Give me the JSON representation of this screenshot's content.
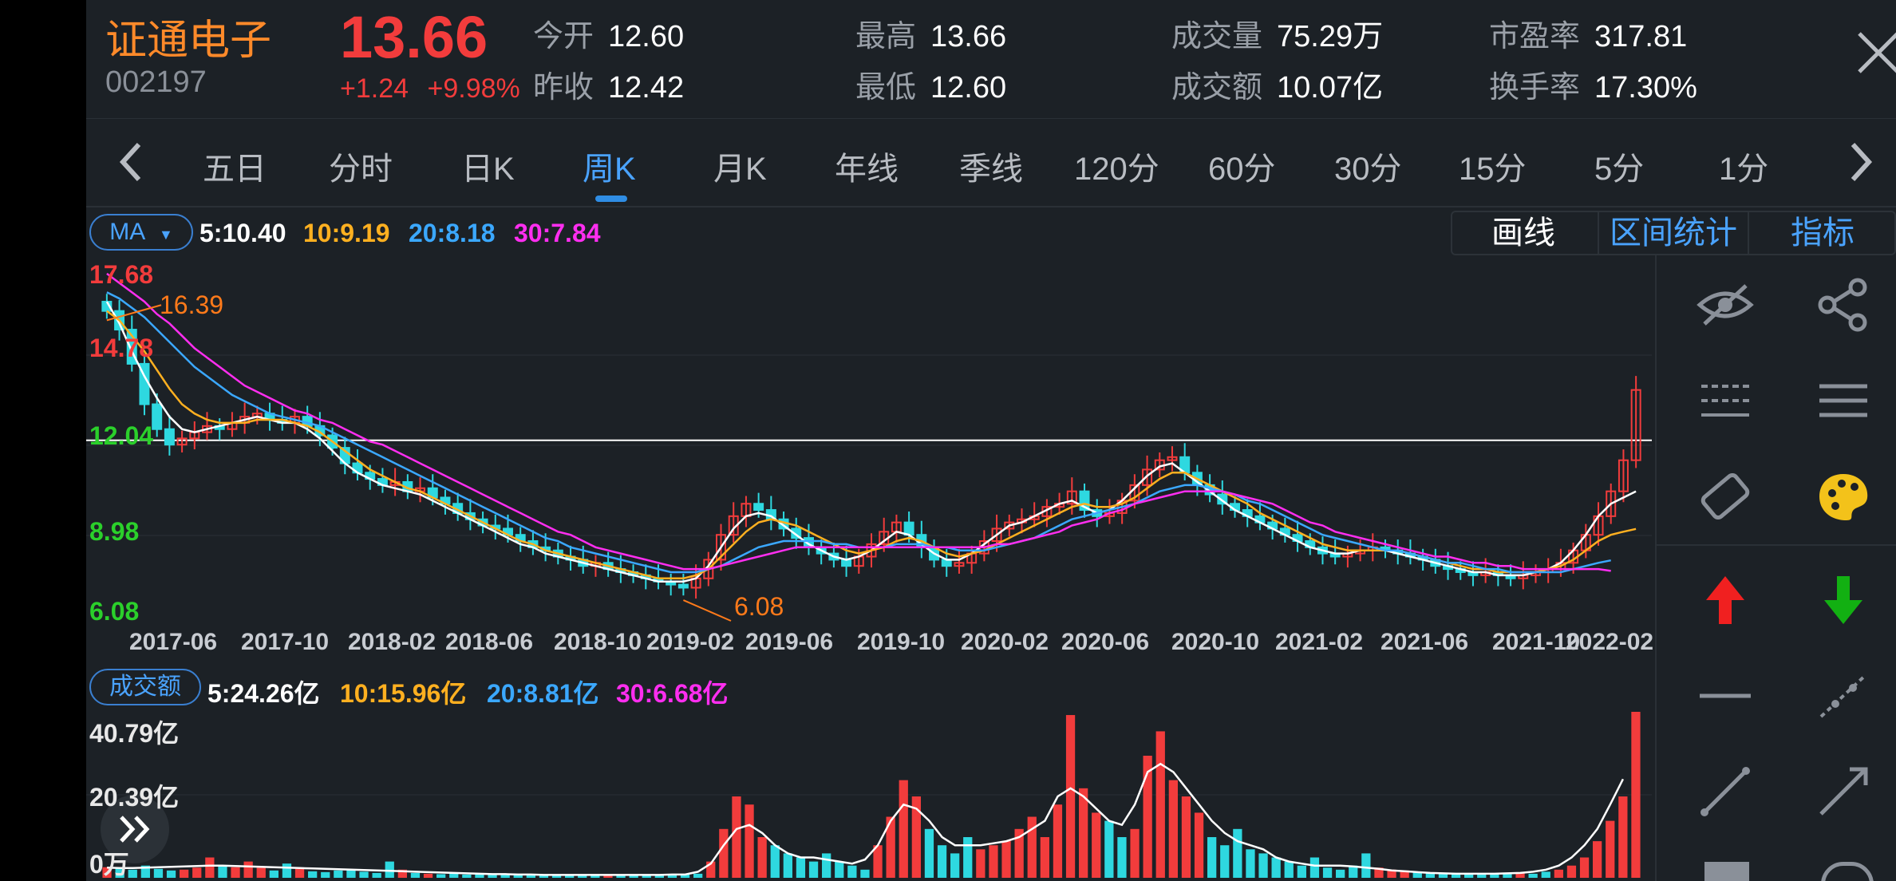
{
  "header": {
    "name": "证通电子",
    "code": "002197",
    "price": "13.66",
    "change": "+1.24",
    "change_pct": "+9.98%",
    "stats": [
      {
        "label": "今开",
        "value": "12.60"
      },
      {
        "label": "昨收",
        "value": "12.42"
      },
      {
        "label": "最高",
        "value": "13.66"
      },
      {
        "label": "最低",
        "value": "12.60"
      },
      {
        "label": "成交量",
        "value": "75.29万"
      },
      {
        "label": "成交额",
        "value": "10.07亿"
      },
      {
        "label": "市盈率",
        "value": "317.81"
      },
      {
        "label": "换手率",
        "value": "17.30%"
      }
    ]
  },
  "tabs": [
    "五日",
    "分时",
    "日K",
    "周K",
    "月K",
    "年线",
    "季线",
    "120分",
    "60分",
    "30分",
    "15分",
    "5分",
    "1分"
  ],
  "active_tab": "周K",
  "ma_bar": {
    "indicator": "MA",
    "values": [
      "5:10.40",
      "10:9.19",
      "20:8.18",
      "30:7.84"
    ]
  },
  "tool_buttons": [
    "画线",
    "区间统计",
    "指标"
  ],
  "vol_bar": {
    "indicator": "成交额",
    "values": [
      "5:24.26亿",
      "10:15.96亿",
      "20:8.81亿",
      "30:6.68亿"
    ]
  },
  "colors": {
    "up": "#f23c3c",
    "down": "#2ed8e0",
    "ma5": "#ffffff",
    "ma10": "#ffb020",
    "ma20": "#3ba8ff",
    "ma30": "#ff2ef0",
    "accent": "#2f8de4"
  },
  "icons": [
    "eye-off-icon",
    "share-icon",
    "dashed-lines-icon",
    "solid-lines-icon",
    "eraser-icon",
    "palette-icon",
    "red-up-arrow-icon",
    "green-down-arrow-icon",
    "horizontal-line-icon",
    "dotted-segment-icon",
    "segment-icon",
    "ray-icon",
    "close-icon",
    "chevron-left-icon",
    "chevron-right-icon",
    "double-chevron-right-icon"
  ],
  "chart_data": [
    {
      "type": "candlestick",
      "title": "",
      "y_labels": [
        "17.68",
        "14.78",
        "12.04",
        "8.98",
        "6.08"
      ],
      "y_label_colors": [
        "#f23c3c",
        "#f23c3c",
        "#2bd02b",
        "#2bd02b",
        "#2bd02b"
      ],
      "ylim": [
        6.08,
        17.68
      ],
      "x_labels": [
        "2017-06",
        "2017-10",
        "2018-02",
        "2018-06",
        "2018-10",
        "2019-02",
        "2019-06",
        "2019-10",
        "2020-02",
        "2020-06",
        "2020-10",
        "2021-02",
        "2021-06",
        "2021-10",
        "2022-02"
      ],
      "annotations": {
        "high": "16.39",
        "low": "6.08"
      },
      "reference_line": 12.04,
      "close": [
        16.2,
        15.6,
        14.5,
        13.2,
        12.4,
        11.9,
        12.1,
        12.3,
        12.5,
        12.4,
        12.6,
        12.8,
        12.9,
        12.7,
        12.6,
        12.8,
        12.5,
        12.2,
        11.8,
        11.3,
        11.0,
        10.8,
        10.6,
        10.7,
        10.4,
        10.5,
        10.2,
        10.0,
        9.7,
        9.5,
        9.3,
        9.2,
        9.0,
        8.8,
        8.6,
        8.5,
        8.3,
        8.2,
        8.0,
        8.1,
        7.9,
        7.8,
        7.7,
        7.6,
        7.5,
        7.4,
        7.3,
        7.6,
        8.2,
        9.0,
        9.6,
        10.0,
        9.8,
        9.5,
        9.2,
        8.9,
        8.6,
        8.4,
        8.2,
        8.0,
        8.3,
        8.7,
        9.1,
        9.4,
        9.0,
        8.6,
        8.2,
        8.0,
        8.1,
        8.4,
        8.8,
        9.2,
        9.4,
        9.5,
        9.6,
        9.9,
        10.0,
        10.4,
        9.8,
        9.6,
        9.7,
        10.1,
        10.6,
        11.1,
        11.4,
        11.5,
        11.0,
        10.6,
        10.3,
        10.0,
        9.8,
        9.6,
        9.4,
        9.2,
        9.0,
        8.8,
        8.6,
        8.4,
        8.3,
        8.4,
        8.5,
        8.6,
        8.5,
        8.4,
        8.3,
        8.2,
        8.0,
        7.9,
        7.8,
        7.7,
        7.8,
        7.7,
        7.6,
        7.7,
        7.8,
        7.9,
        8.1,
        8.5,
        9.0,
        9.6,
        10.4,
        11.4,
        13.66
      ],
      "ma": {
        "5": [
          16.5,
          15.8,
          14.9,
          14.1,
          13.4,
          12.8,
          12.4,
          12.3,
          12.4,
          12.5,
          12.6,
          12.7,
          12.8,
          12.7,
          12.6,
          12.6,
          12.4,
          12.1,
          11.7,
          11.3,
          11.0,
          10.8,
          10.6,
          10.5,
          10.4,
          10.3,
          10.1,
          9.9,
          9.7,
          9.5,
          9.3,
          9.1,
          8.9,
          8.7,
          8.6,
          8.4,
          8.3,
          8.2,
          8.1,
          8.0,
          7.9,
          7.8,
          7.7,
          7.6,
          7.5,
          7.5,
          7.5,
          7.6,
          8.0,
          8.6,
          9.2,
          9.6,
          9.7,
          9.6,
          9.3,
          9.0,
          8.7,
          8.5,
          8.3,
          8.2,
          8.3,
          8.5,
          8.8,
          9.1,
          9.0,
          8.7,
          8.4,
          8.2,
          8.2,
          8.4,
          8.7,
          9.0,
          9.3,
          9.4,
          9.6,
          9.8,
          10.0,
          10.1,
          9.9,
          9.7,
          9.8,
          10.1,
          10.5,
          10.9,
          11.2,
          11.3,
          11.0,
          10.7,
          10.4,
          10.1,
          9.8,
          9.6,
          9.4,
          9.2,
          9.0,
          8.8,
          8.6,
          8.5,
          8.4,
          8.4,
          8.5,
          8.5,
          8.5,
          8.4,
          8.3,
          8.2,
          8.1,
          8.0,
          7.9,
          7.8,
          7.8,
          7.7,
          7.7,
          7.7,
          7.8,
          7.9,
          8.1,
          8.5,
          9.0,
          9.6,
          10.0,
          10.2,
          10.4
        ],
        "10": [
          16.2,
          15.9,
          15.4,
          14.9,
          14.3,
          13.7,
          13.2,
          12.9,
          12.7,
          12.6,
          12.6,
          12.6,
          12.7,
          12.7,
          12.7,
          12.6,
          12.5,
          12.3,
          12.0,
          11.7,
          11.4,
          11.1,
          10.9,
          10.7,
          10.5,
          10.4,
          10.2,
          10.0,
          9.8,
          9.6,
          9.4,
          9.2,
          9.0,
          8.8,
          8.7,
          8.5,
          8.4,
          8.3,
          8.2,
          8.1,
          8.0,
          7.9,
          7.8,
          7.7,
          7.6,
          7.6,
          7.6,
          7.7,
          7.9,
          8.3,
          8.7,
          9.1,
          9.4,
          9.5,
          9.4,
          9.3,
          9.1,
          8.9,
          8.7,
          8.5,
          8.4,
          8.5,
          8.6,
          8.8,
          8.9,
          8.8,
          8.6,
          8.4,
          8.3,
          8.4,
          8.5,
          8.7,
          8.9,
          9.1,
          9.3,
          9.5,
          9.7,
          9.9,
          10.0,
          9.9,
          9.9,
          10.0,
          10.2,
          10.5,
          10.8,
          11.0,
          11.0,
          10.8,
          10.6,
          10.4,
          10.2,
          10.0,
          9.7,
          9.5,
          9.3,
          9.1,
          8.9,
          8.7,
          8.6,
          8.5,
          8.5,
          8.5,
          8.5,
          8.5,
          8.4,
          8.3,
          8.2,
          8.1,
          8.0,
          7.9,
          7.9,
          7.8,
          7.8,
          7.8,
          7.8,
          7.9,
          8.0,
          8.2,
          8.5,
          8.8,
          9.0,
          9.1,
          9.19
        ],
        "20": [
          16.8,
          16.6,
          16.3,
          16.0,
          15.6,
          15.2,
          14.8,
          14.4,
          14.1,
          13.8,
          13.5,
          13.3,
          13.1,
          12.9,
          12.8,
          12.7,
          12.6,
          12.5,
          12.3,
          12.1,
          11.9,
          11.7,
          11.5,
          11.3,
          11.1,
          10.9,
          10.7,
          10.5,
          10.3,
          10.1,
          9.9,
          9.7,
          9.5,
          9.3,
          9.1,
          8.9,
          8.8,
          8.6,
          8.5,
          8.4,
          8.3,
          8.2,
          8.1,
          8.0,
          7.9,
          7.8,
          7.8,
          7.8,
          7.9,
          8.0,
          8.2,
          8.4,
          8.6,
          8.7,
          8.8,
          8.8,
          8.8,
          8.8,
          8.7,
          8.7,
          8.6,
          8.6,
          8.6,
          8.7,
          8.7,
          8.7,
          8.6,
          8.6,
          8.5,
          8.5,
          8.5,
          8.6,
          8.7,
          8.8,
          8.9,
          9.1,
          9.3,
          9.5,
          9.6,
          9.7,
          9.8,
          9.9,
          10.0,
          10.2,
          10.4,
          10.5,
          10.6,
          10.6,
          10.5,
          10.4,
          10.3,
          10.1,
          10.0,
          9.8,
          9.6,
          9.4,
          9.2,
          9.0,
          8.9,
          8.8,
          8.7,
          8.6,
          8.5,
          8.5,
          8.4,
          8.3,
          8.2,
          8.1,
          8.1,
          8.0,
          7.9,
          7.9,
          7.8,
          7.8,
          7.8,
          7.8,
          7.8,
          7.9,
          8.0,
          8.1,
          8.18
        ],
        "30": [
          17.4,
          17.1,
          16.8,
          16.5,
          16.1,
          15.8,
          15.4,
          15.0,
          14.7,
          14.4,
          14.1,
          13.8,
          13.6,
          13.4,
          13.2,
          13.0,
          12.9,
          12.7,
          12.6,
          12.4,
          12.2,
          12.0,
          11.9,
          11.7,
          11.5,
          11.3,
          11.1,
          10.9,
          10.7,
          10.5,
          10.3,
          10.1,
          9.9,
          9.7,
          9.5,
          9.3,
          9.1,
          9.0,
          8.8,
          8.6,
          8.5,
          8.4,
          8.3,
          8.2,
          8.1,
          8.0,
          7.9,
          7.9,
          7.9,
          8.0,
          8.1,
          8.2,
          8.3,
          8.4,
          8.5,
          8.6,
          8.6,
          8.6,
          8.6,
          8.6,
          8.6,
          8.6,
          8.6,
          8.6,
          8.6,
          8.6,
          8.6,
          8.6,
          8.6,
          8.6,
          8.6,
          8.7,
          8.7,
          8.8,
          8.9,
          9.0,
          9.1,
          9.3,
          9.4,
          9.5,
          9.7,
          9.8,
          10.0,
          10.1,
          10.2,
          10.3,
          10.4,
          10.4,
          10.4,
          10.4,
          10.3,
          10.2,
          10.1,
          10.0,
          9.8,
          9.6,
          9.4,
          9.3,
          9.1,
          9.0,
          8.9,
          8.8,
          8.7,
          8.6,
          8.5,
          8.4,
          8.3,
          8.3,
          8.2,
          8.1,
          8.1,
          8.0,
          8.0,
          7.9,
          7.9,
          7.9,
          7.9,
          7.9,
          7.9,
          7.9,
          7.84
        ]
      }
    },
    {
      "type": "bar",
      "title": "",
      "y_labels": [
        "40.79亿",
        "20.39亿",
        "0万"
      ],
      "ylim": [
        0,
        40.79
      ],
      "unit": "亿",
      "values": [
        2.6,
        2.4,
        2.0,
        3.0,
        2.2,
        1.8,
        2.0,
        2.5,
        5.0,
        3.0,
        2.6,
        4.0,
        2.5,
        1.8,
        3.5,
        2.2,
        1.6,
        1.4,
        1.8,
        2.0,
        1.5,
        1.2,
        4.0,
        2.0,
        1.2,
        1.0,
        0.9,
        1.0,
        0.8,
        1.1,
        0.9,
        0.8,
        0.7,
        0.6,
        0.8,
        0.6,
        0.5,
        0.7,
        0.6,
        0.8,
        0.7,
        0.6,
        0.7,
        0.6,
        0.9,
        0.8,
        1.0,
        4.0,
        12.0,
        20.0,
        18.0,
        10.0,
        8.0,
        6.0,
        5.0,
        4.0,
        6.0,
        4.0,
        3.0,
        2.0,
        8.0,
        15.0,
        24.0,
        20.0,
        12.0,
        8.0,
        6.0,
        10.0,
        7.0,
        8.0,
        9.0,
        12.0,
        15.0,
        10.0,
        18.0,
        40.0,
        22.0,
        16.0,
        14.0,
        10.0,
        12.0,
        30.0,
        36.0,
        24.0,
        20.0,
        16.0,
        10.0,
        8.0,
        12.0,
        7.0,
        6.0,
        5.0,
        4.0,
        3.0,
        5.0,
        2.5,
        2.0,
        3.0,
        6.0,
        2.5,
        2.0,
        1.8,
        1.5,
        1.2,
        1.0,
        1.2,
        1.0,
        0.8,
        1.0,
        0.9,
        1.2,
        1.0,
        1.5,
        2.0,
        3.0,
        5.0,
        9.0,
        14.0,
        20.0,
        40.79
      ],
      "ma5": [
        2.5,
        2.4,
        2.4,
        2.5,
        2.6,
        2.7,
        2.8,
        2.9,
        3.0,
        3.0,
        2.9,
        2.8,
        2.7,
        2.6,
        2.5,
        2.4,
        2.3,
        2.2,
        2.1,
        2.0,
        1.9,
        1.8,
        1.7,
        1.6,
        1.5,
        1.4,
        1.3,
        1.2,
        1.1,
        1.0,
        0.9,
        0.9,
        0.8,
        0.8,
        0.7,
        0.7,
        0.7,
        0.7,
        0.7,
        0.7,
        0.7,
        0.7,
        0.7,
        0.7,
        0.8,
        0.8,
        1.5,
        3.5,
        8.0,
        12.0,
        13.0,
        11.0,
        8.0,
        6.0,
        5.0,
        5.0,
        4.5,
        4.0,
        3.5,
        4.5,
        8.0,
        14.0,
        18.0,
        17.0,
        14.0,
        10.0,
        8.0,
        8.0,
        8.0,
        8.5,
        9.0,
        10.0,
        12.0,
        14.0,
        20.0,
        22.0,
        20.0,
        17.0,
        14.0,
        13.0,
        18.0,
        26.0,
        28.0,
        26.0,
        22.0,
        18.0,
        14.0,
        11.0,
        9.0,
        8.0,
        7.0,
        5.0,
        4.0,
        3.5,
        3.0,
        3.0,
        3.0,
        2.8,
        2.5,
        2.2,
        1.8,
        1.6,
        1.4,
        1.2,
        1.1,
        1.0,
        1.0,
        1.0,
        1.0,
        1.1,
        1.2,
        1.5,
        2.0,
        3.0,
        5.0,
        8.0,
        12.0,
        18.0,
        24.26
      ]
    }
  ]
}
